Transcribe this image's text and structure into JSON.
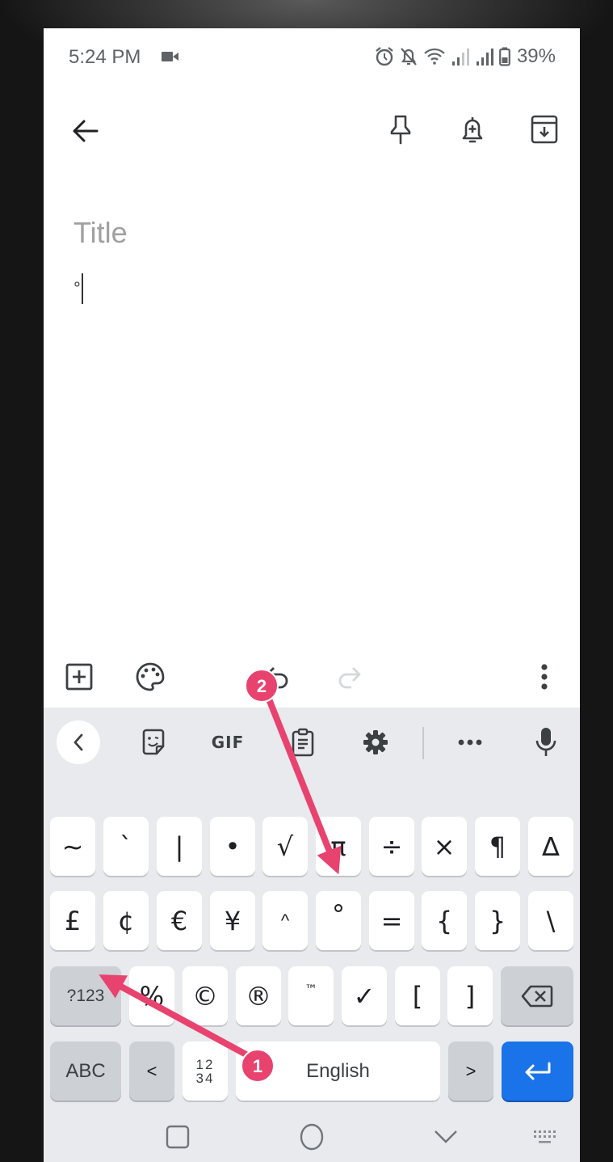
{
  "status_bar": {
    "time": "5:24 PM",
    "icons": [
      "video-record-icon",
      "alarm-icon",
      "notifications-off-icon",
      "wifi-icon",
      "signal-icon",
      "signal-icon",
      "battery-icon"
    ],
    "battery_percent": "39%"
  },
  "app_bar": {
    "back_icon": "arrow-left-icon",
    "actions": [
      {
        "name": "pin",
        "icon": "pin-icon"
      },
      {
        "name": "reminder",
        "icon": "bell-plus-icon"
      },
      {
        "name": "archive",
        "icon": "archive-icon"
      }
    ]
  },
  "note": {
    "title_placeholder": "Title",
    "title_value": "",
    "body_value": "°"
  },
  "editor_toolbar": {
    "items": [
      {
        "name": "add",
        "icon": "add-box-icon"
      },
      {
        "name": "palette",
        "icon": "palette-icon"
      },
      {
        "name": "undo",
        "icon": "undo-icon"
      },
      {
        "name": "redo",
        "icon": "redo-icon",
        "disabled": true
      },
      {
        "name": "more",
        "icon": "more-vert-icon"
      }
    ]
  },
  "keyboard": {
    "toolbar": {
      "back_icon": "chevron-left-icon",
      "sticker_icon": "sticker-icon",
      "gif_label": "GIF",
      "clipboard_icon": "clipboard-icon",
      "settings_icon": "gear-icon",
      "more_icon": "more-horiz-icon",
      "mic_icon": "mic-icon"
    },
    "rows": [
      [
        "~",
        "`",
        "|",
        "•",
        "√",
        "π",
        "÷",
        "×",
        "¶",
        "∆"
      ],
      [
        "£",
        "¢",
        "€",
        "¥",
        "^",
        "°",
        "=",
        "{",
        "}",
        "\\"
      ],
      [
        "%",
        "©",
        "®",
        "™",
        "✓",
        "[",
        "]"
      ]
    ],
    "symbols_toggle_label": "?123",
    "abc_label": "ABC",
    "less_than_label": "<",
    "numpad_label_top": "12",
    "numpad_label_bottom": "34",
    "space_label": "English",
    "greater_than_label": ">",
    "backspace_icon": "backspace-icon",
    "enter_icon": "enter-icon",
    "accent_color": "#1a73e8"
  },
  "nav_bar": {
    "items": [
      "recents-icon",
      "home-icon",
      "back-down-icon",
      "keyboard-switch-icon"
    ]
  },
  "annotations": {
    "badge_color": "#e8436f",
    "markers": [
      {
        "label": "1",
        "description": "arrow to ?123 key"
      },
      {
        "label": "2",
        "description": "arrow to ° key"
      }
    ]
  }
}
